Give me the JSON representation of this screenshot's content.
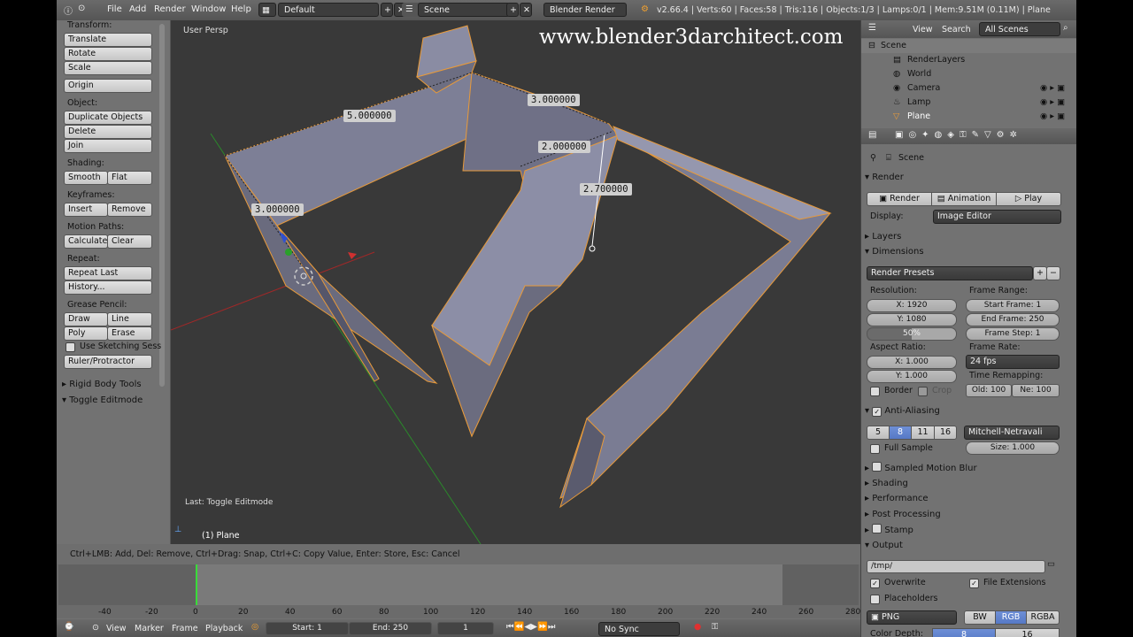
{
  "header": {
    "menus": [
      "File",
      "Add",
      "Render",
      "Window",
      "Help"
    ],
    "layout": "Default",
    "scene": "Scene",
    "engine": "Blender Render",
    "stats": "v2.66.4 | Verts:60 | Faces:58 | Tris:116 | Objects:1/3 | Lamps:0/1 | Mem:9.51M (0.11M) | Plane"
  },
  "toolshelf": {
    "transform_label": "Transform:",
    "translate": "Translate",
    "rotate": "Rotate",
    "scale": "Scale",
    "origin": "Origin",
    "object_label": "Object:",
    "duplicate": "Duplicate Objects",
    "delete": "Delete",
    "join": "Join",
    "shading_label": "Shading:",
    "smooth": "Smooth",
    "flat": "Flat",
    "keyframes_label": "Keyframes:",
    "insert": "Insert",
    "remove": "Remove",
    "motion_label": "Motion Paths:",
    "calculate": "Calculate",
    "clear": "Clear",
    "repeat_label": "Repeat:",
    "repeat_last": "Repeat Last",
    "history": "History...",
    "grease_label": "Grease Pencil:",
    "draw": "Draw",
    "line": "Line",
    "poly": "Poly",
    "erase": "Erase",
    "sketching": "Use Sketching Sess",
    "ruler": "Ruler/Protractor",
    "rigid": "Rigid Body Tools",
    "toggle_edit": "Toggle Editmode"
  },
  "viewport": {
    "view_label": "User Persp",
    "watermark": "www.blender3darchitect.com",
    "last_op": "Last: Toggle Editmode",
    "object": "(1) Plane",
    "dimensions": [
      "5.000000",
      "3.000000",
      "2.000000",
      "2.700000",
      "3.000000"
    ]
  },
  "status_text": "Ctrl+LMB: Add, Del: Remove, Ctrl+Drag: Snap, Ctrl+C: Copy Value, Enter: Store,  Esc: Cancel",
  "timeline": {
    "ticks": [
      "-40",
      "-20",
      "0",
      "20",
      "40",
      "60",
      "80",
      "100",
      "120",
      "140",
      "160",
      "180",
      "200",
      "220",
      "240",
      "260",
      "280"
    ],
    "view": "View",
    "marker": "Marker",
    "frame": "Frame",
    "playback": "Playback",
    "start": "Start: 1",
    "end": "End: 250",
    "current": "1",
    "sync": "No Sync"
  },
  "outliner": {
    "view": "View",
    "search": "Search",
    "filter": "All Scenes",
    "rows": [
      "Scene",
      "RenderLayers",
      "World",
      "Camera",
      "Lamp",
      "Plane"
    ]
  },
  "properties": {
    "context": "Scene",
    "render_panel": "Render",
    "render_btn": "Render",
    "animation_btn": "Animation",
    "play_btn": "Play",
    "display_label": "Display:",
    "display_value": "Image Editor",
    "layers": "Layers",
    "dimensions": "Dimensions",
    "presets": "Render Presets",
    "resolution_label": "Resolution:",
    "res_x": "X: 1920",
    "res_y": "Y: 1080",
    "res_pct": "50%",
    "frame_range_label": "Frame Range:",
    "start_frame": "Start Frame: 1",
    "end_frame": "End Frame: 250",
    "frame_step": "Frame Step: 1",
    "aspect_label": "Aspect Ratio:",
    "aspect_x": "X: 1.000",
    "aspect_y": "Y: 1.000",
    "frame_rate_label": "Frame Rate:",
    "frame_rate": "24 fps",
    "border": "Border",
    "crop": "Crop",
    "time_remap_label": "Time Remapping:",
    "old": "Old: 100",
    "new": "Ne: 100",
    "aa": "Anti-Aliasing",
    "aa_samples": [
      "5",
      "8",
      "11",
      "16"
    ],
    "aa_filter": "Mitchell-Netravali",
    "full_sample": "Full Sample",
    "size": "Size: 1.000",
    "motion_blur": "Sampled Motion Blur",
    "shading": "Shading",
    "performance": "Performance",
    "post_processing": "Post Processing",
    "stamp": "Stamp",
    "output": "Output",
    "output_path": "/tmp/",
    "overwrite": "Overwrite",
    "file_ext": "File Extensions",
    "placeholders": "Placeholders",
    "format": "PNG",
    "bw": "BW",
    "rgb": "RGB",
    "rgba": "RGBA",
    "color_depth": "Color Depth:",
    "depth_8": "8",
    "depth_16": "16"
  }
}
